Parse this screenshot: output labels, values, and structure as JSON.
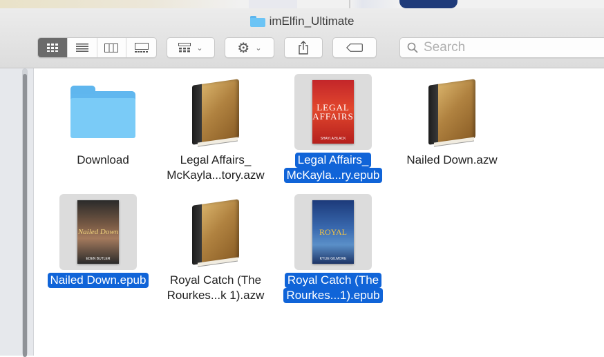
{
  "window": {
    "title": "imElfin_Ultimate"
  },
  "toolbar": {
    "view_buttons": [
      {
        "name": "icon-view",
        "icon": "grid-icon",
        "active": true
      },
      {
        "name": "list-view",
        "icon": "list-icon",
        "active": false
      },
      {
        "name": "column-view",
        "icon": "columns-icon",
        "active": false
      },
      {
        "name": "gallery-view",
        "icon": "gallery-icon",
        "active": false
      }
    ],
    "search_placeholder": "Search"
  },
  "files": [
    {
      "name": "Download",
      "kind": "folder",
      "selected": false,
      "lines": [
        "Download"
      ]
    },
    {
      "name": "Legal Affairs azw",
      "kind": "book",
      "selected": false,
      "lines": [
        "Legal Affairs_",
        "McKayla...tory.azw"
      ]
    },
    {
      "name": "Legal Affairs epub",
      "kind": "cover-legal",
      "selected": true,
      "lines": [
        "Legal Affairs_",
        "McKayla...ry.epub"
      ],
      "cover_title": "LEGAL AFFAIRS",
      "cover_author": "SHAYLA BLACK"
    },
    {
      "name": "Nailed Down azw",
      "kind": "book",
      "selected": false,
      "lines": [
        "Nailed Down.azw"
      ]
    },
    {
      "name": "Nailed Down epub",
      "kind": "cover-nailed",
      "selected": true,
      "lines": [
        "Nailed Down.epub"
      ],
      "cover_title": "Nailed Down",
      "cover_author": "EDEN BUTLER"
    },
    {
      "name": "Royal Catch azw",
      "kind": "book",
      "selected": false,
      "lines": [
        "Royal Catch (The",
        "Rourkes...k 1).azw"
      ]
    },
    {
      "name": "Royal Catch epub",
      "kind": "cover-royal",
      "selected": true,
      "lines": [
        "Royal Catch (The",
        "Rourkes...1).epub"
      ],
      "cover_title": "ROYAL",
      "cover_author": "KYLIE GILMORE"
    }
  ],
  "colors": {
    "selection": "#1064d8",
    "folder": "#7acbf7"
  }
}
